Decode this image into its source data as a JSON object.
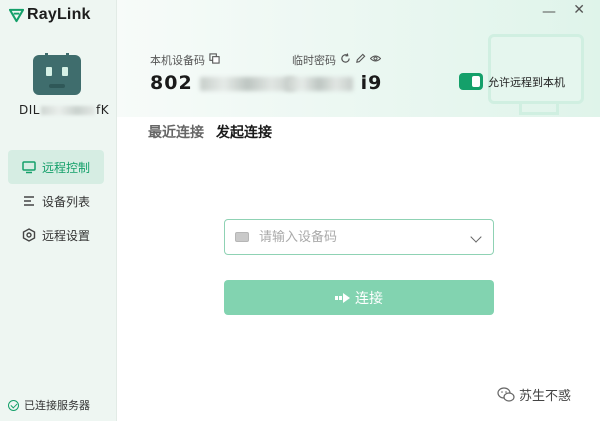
{
  "app": {
    "name": "RayLink"
  },
  "window": {
    "minimize": "—",
    "close": "✕"
  },
  "sidebar": {
    "device_name": "DIL",
    "device_name_suffix": "fK",
    "items": [
      {
        "label": "远程控制",
        "icon": "monitor-icon",
        "active": true
      },
      {
        "label": "设备列表",
        "icon": "list-icon",
        "active": false
      },
      {
        "label": "远程设置",
        "icon": "settings-icon",
        "active": false
      }
    ],
    "status": "已连接服务器"
  },
  "header": {
    "device_code_label": "本机设备码",
    "device_code_prefix": "802",
    "temp_password_label": "临时密码",
    "temp_password_suffix": "i9",
    "allow_remote_label": "允许远程到本机",
    "allow_remote_on": true
  },
  "tabs": [
    {
      "label": "最近连接",
      "active": false
    },
    {
      "label": "发起连接",
      "active": true
    }
  ],
  "connect": {
    "input_placeholder": "请输入设备码",
    "button_label": "连接"
  },
  "watermark": "苏生不惑",
  "colors": {
    "accent": "#14a06a",
    "button": "#82d3b0",
    "sidebar_bg": "#eef6f2"
  }
}
